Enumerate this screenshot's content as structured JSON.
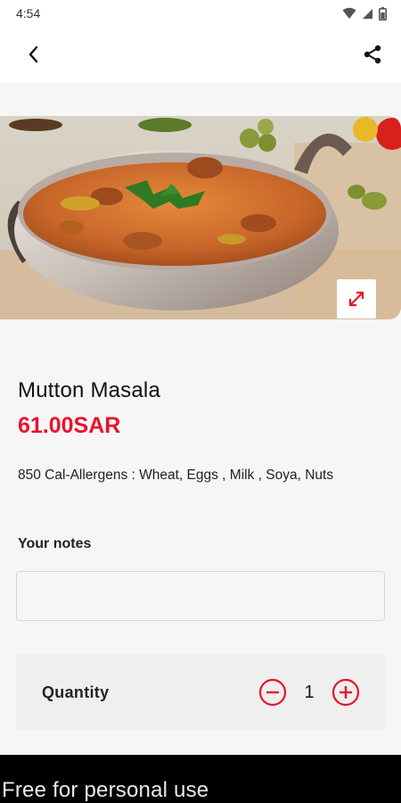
{
  "status_bar": {
    "time": "4:54"
  },
  "item": {
    "name": "Mutton Masala",
    "price": "61.00SAR",
    "info": "850 Cal-Allergens : Wheat, Eggs , Milk , Soya, Nuts"
  },
  "notes": {
    "label": "Your notes",
    "value": "",
    "placeholder": ""
  },
  "quantity": {
    "label": "Quantity",
    "value": "1"
  },
  "footer": {
    "text": "Free for personal use"
  },
  "colors": {
    "accent": "#e8132b",
    "background": "#f6f6f6",
    "card": "#efefef"
  },
  "icons": {
    "back": "arrow-back-icon",
    "share": "share-icon",
    "expand": "expand-icon",
    "minus": "minus-circle-icon",
    "plus": "plus-circle-icon"
  }
}
